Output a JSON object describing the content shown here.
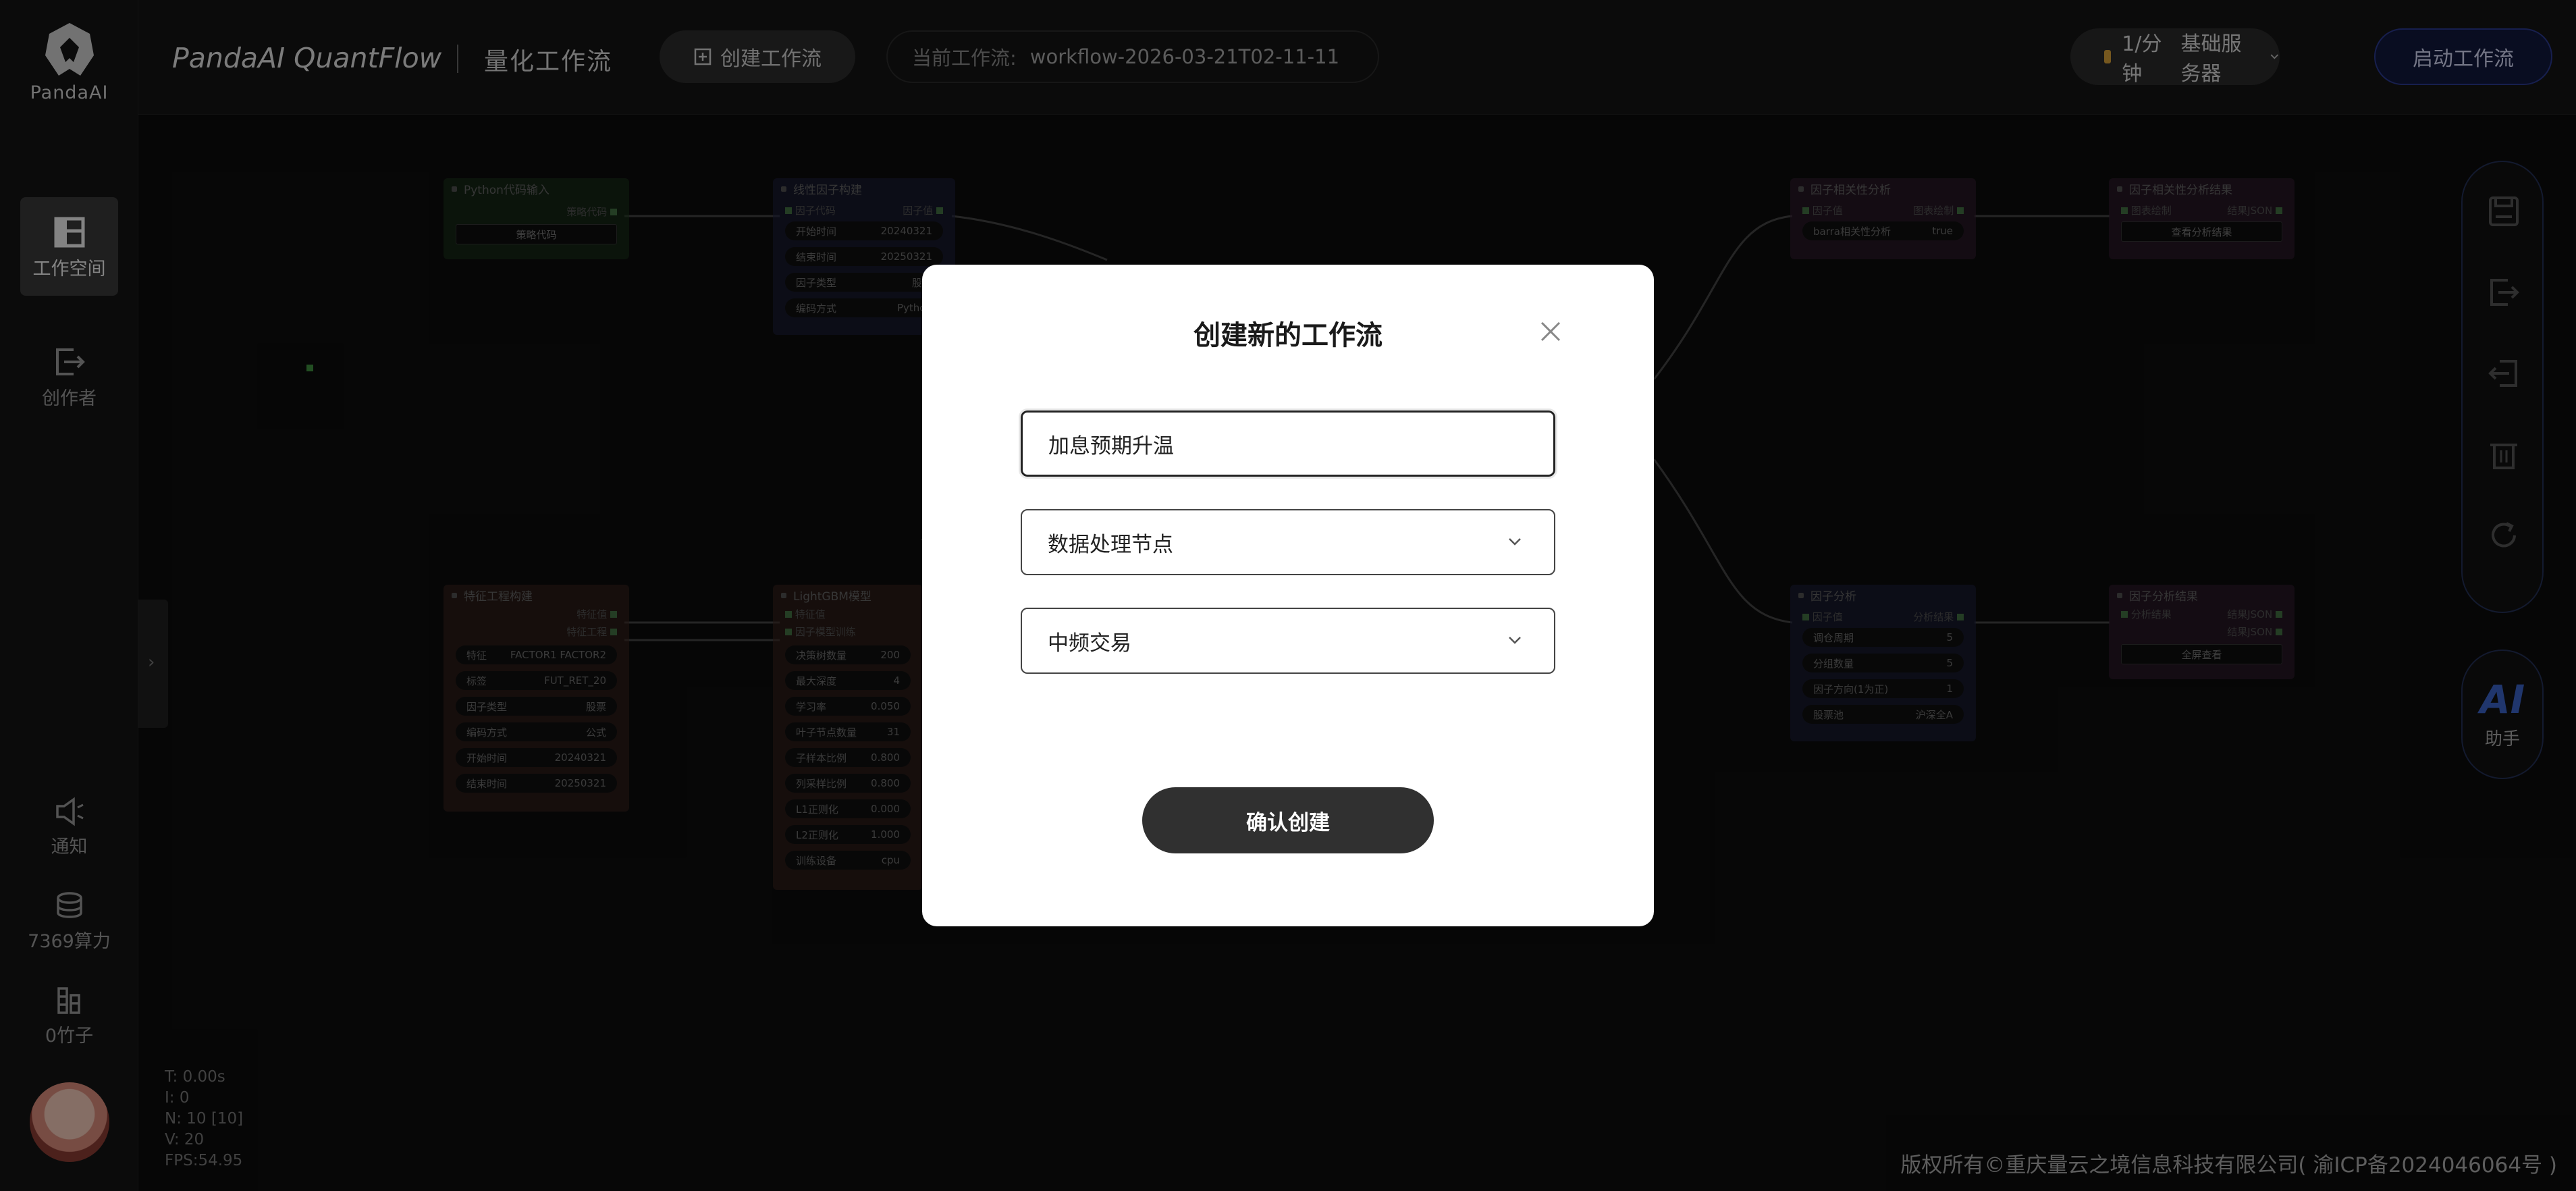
{
  "sidebar": {
    "logo_text": "PandaAI",
    "items": [
      {
        "label": "工作空间",
        "icon": "workspace-icon"
      },
      {
        "label": "创作者",
        "icon": "creator-icon"
      },
      {
        "label": "通知",
        "icon": "speaker-icon"
      },
      {
        "label": "7369算力",
        "icon": "coins-stack-icon"
      },
      {
        "label": "0竹子",
        "icon": "bamboo-icon"
      }
    ]
  },
  "topbar": {
    "brand": "PandaAI QuantFlow",
    "subtitle": "量化工作流",
    "create_label": "创建工作流",
    "current_label": "当前工作流:",
    "current_value": "workflow-2026-03-21T02-11-11",
    "rate": "1/分钟",
    "server": "基础服务器",
    "start_label": "启动工作流"
  },
  "nodes": {
    "python_input": {
      "title": "Python代码输入",
      "out": "策略代码",
      "button": "策略代码"
    },
    "linear_factor": {
      "title": "线性因子构建",
      "in": "因子代码",
      "out": "因子值",
      "fields": [
        {
          "k": "开始时间",
          "v": "20240321"
        },
        {
          "k": "结束时间",
          "v": "20250321"
        },
        {
          "k": "因子类型",
          "v": "股票"
        },
        {
          "k": "编码方式",
          "v": "Python"
        }
      ]
    },
    "feature_eng": {
      "title": "特征工程构建",
      "out1": "特征值",
      "out2": "特征工程",
      "fields": [
        {
          "k": "特征",
          "v": "FACTOR1 FACTOR2"
        },
        {
          "k": "标签",
          "v": "FUT_RET_20"
        },
        {
          "k": "因子类型",
          "v": "股票"
        },
        {
          "k": "编码方式",
          "v": "公式"
        },
        {
          "k": "开始时间",
          "v": "20240321"
        },
        {
          "k": "结束时间",
          "v": "20250321"
        }
      ]
    },
    "lightgbm": {
      "title": "LightGBM模型",
      "in1": "特征值",
      "in2": "因子模型训练",
      "fields": [
        {
          "k": "决策树数量",
          "v": "200"
        },
        {
          "k": "最大深度",
          "v": "4"
        },
        {
          "k": "学习率",
          "v": "0.050"
        },
        {
          "k": "叶子节点数量",
          "v": "31"
        },
        {
          "k": "子样本比例",
          "v": "0.800"
        },
        {
          "k": "列采样比例",
          "v": "0.800"
        },
        {
          "k": "L1正则化",
          "v": "0.000"
        },
        {
          "k": "L2正则化",
          "v": "1.000"
        },
        {
          "k": "训练设备",
          "v": "cpu"
        }
      ]
    },
    "corr_analysis": {
      "title": "因子相关性分析",
      "in": "因子值",
      "out": "图表绘制",
      "field_k": "barra相关性分析",
      "field_v": "true"
    },
    "corr_result": {
      "title": "因子相关性分析结果",
      "in": "图表绘制",
      "out": "结果JSON",
      "button": "查看分析结果"
    },
    "factor_analysis": {
      "title": "因子分析",
      "in": "因子值",
      "out": "分析结果",
      "fields": [
        {
          "k": "调仓周期",
          "v": "5"
        },
        {
          "k": "分组数量",
          "v": "5"
        },
        {
          "k": "因子方向(1为正)",
          "v": "1"
        },
        {
          "k": "股票池",
          "v": "沪深全A"
        }
      ]
    },
    "factor_result": {
      "title": "因子分析结果",
      "in": "分析结果",
      "out1": "结果JSON",
      "out2": "结果JSON",
      "button": "全屏查看"
    }
  },
  "ai_assistant": {
    "icon_text": "AI",
    "label": "助手"
  },
  "stats": {
    "t": "T: 0.00s",
    "i": "I: 0",
    "n": "N: 10 [10]",
    "v": "V: 20",
    "fps": "FPS:54.95"
  },
  "footer": "版权所有©重庆量云之境信息科技有限公司( 渝ICP备2024046064号 )",
  "modal": {
    "title": "创建新的工作流",
    "name_value": "加息预期升温",
    "type_value": "数据处理节点",
    "freq_value": "中频交易",
    "confirm_label": "确认创建"
  },
  "colors": {
    "accent_blue": "#2b3a8f",
    "modal_button": "#303030",
    "node_green": "#1e3a1e",
    "node_blue": "#1f2244",
    "node_brown": "#3f2720",
    "node_purple": "#3a2038"
  }
}
